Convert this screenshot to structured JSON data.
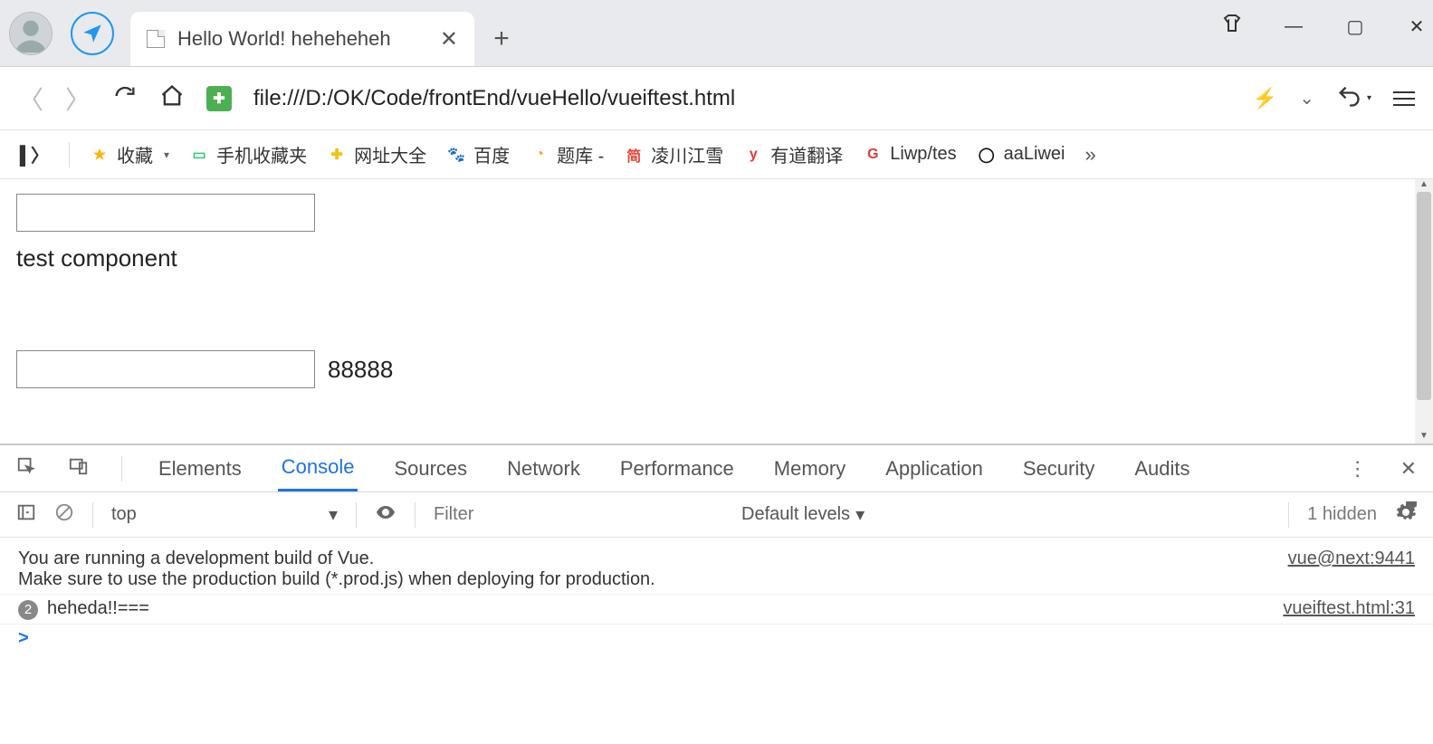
{
  "browser_chrome": {
    "tab_title": "Hello World! heheheheh",
    "url": "file:///D:/OK/Code/frontEnd/vueHello/vueiftest.html"
  },
  "window_controls": {
    "minimize": "—",
    "maximize": "▢",
    "close": "✕"
  },
  "bookmarks": [
    {
      "label": "收藏",
      "icon": "★",
      "color": "#ffb400"
    },
    {
      "label": "手机收藏夹",
      "icon": "▭",
      "color": "#2ecc71"
    },
    {
      "label": "网址大全",
      "icon": "✚",
      "color": "#f1c40f"
    },
    {
      "label": "百度",
      "icon": "🐾",
      "color": "#2f7ef6"
    },
    {
      "label": "题库 -",
      "icon": "◔",
      "color": "#ff9800"
    },
    {
      "label": "凌川江雪",
      "icon": "简",
      "color": "#ea4335"
    },
    {
      "label": "有道翻译",
      "icon": "y",
      "color": "#e53935"
    },
    {
      "label": "Liwp/tes",
      "icon": "G",
      "color": "#e53935"
    },
    {
      "label": "aaLiwei",
      "icon": "◯",
      "color": "#111"
    }
  ],
  "page": {
    "text1": "test component",
    "value2": "88888"
  },
  "devtools": {
    "tabs": [
      "Elements",
      "Console",
      "Sources",
      "Network",
      "Performance",
      "Memory",
      "Application",
      "Security",
      "Audits"
    ],
    "active_tab": "Console",
    "context": "top",
    "filter_placeholder": "Filter",
    "levels_label": "Default levels",
    "hidden_label": "1 hidden",
    "logs": [
      {
        "type": "text",
        "lines": [
          "You are running a development build of Vue.",
          "Make sure to use the production build (*.prod.js) when deploying for production."
        ],
        "source": "vue@next:9441"
      },
      {
        "type": "count",
        "count": "2",
        "message": "heheda!!===",
        "source": "vueiftest.html:31"
      }
    ],
    "prompt": ">"
  }
}
